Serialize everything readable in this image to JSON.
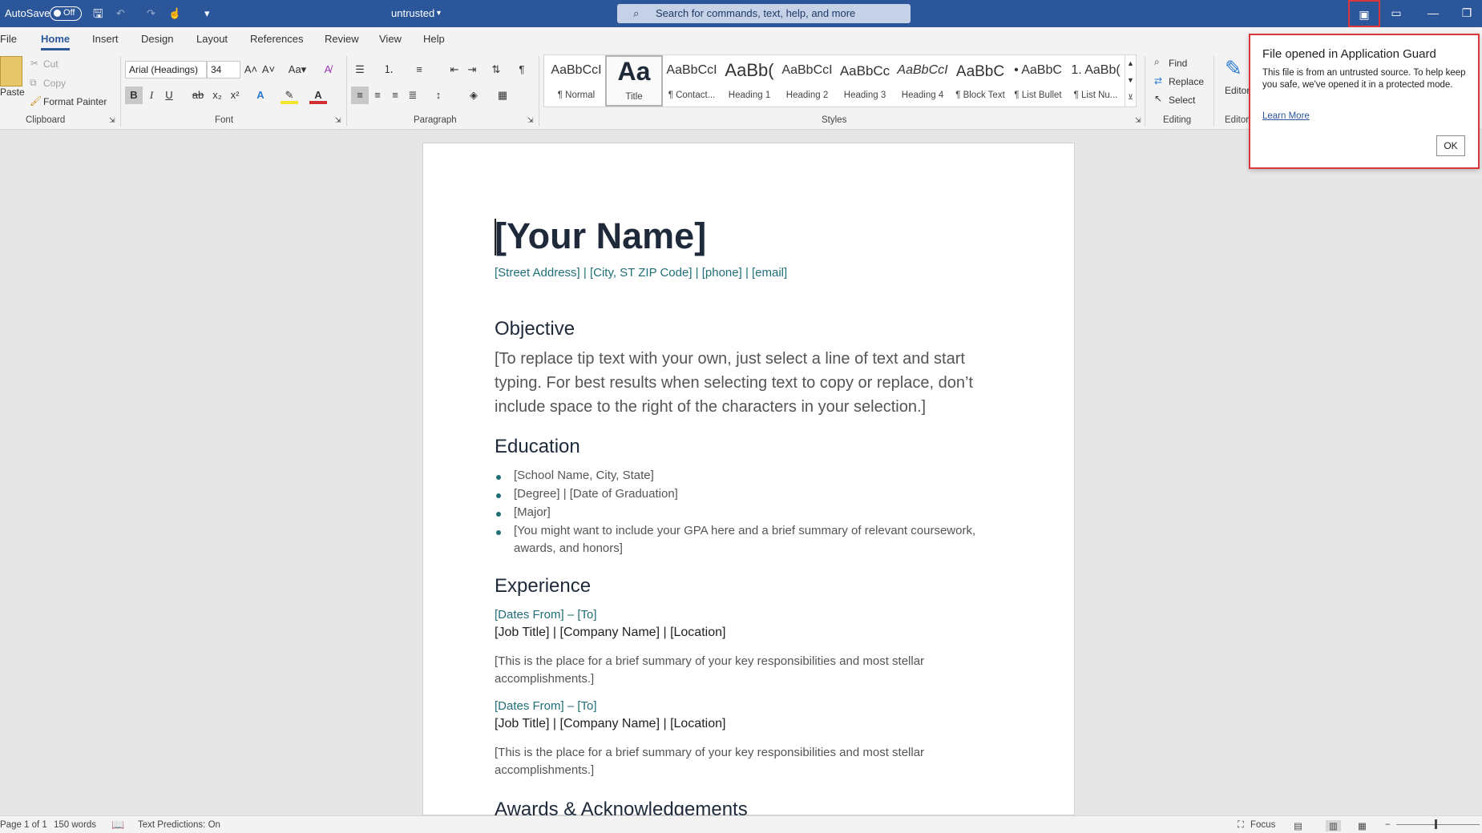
{
  "titlebar": {
    "autosave_label": "AutoSave",
    "autosave_state": "Off",
    "doc_title": "untrusted",
    "search_placeholder": "Search for commands, text, help, and more"
  },
  "tabs": [
    "File",
    "Home",
    "Insert",
    "Design",
    "Layout",
    "References",
    "Review",
    "View",
    "Help"
  ],
  "ribbon": {
    "clipboard": {
      "paste": "Paste",
      "cut": "Cut",
      "copy": "Copy",
      "format_painter": "Format Painter",
      "label": "Clipboard"
    },
    "font": {
      "font_name": "Arial (Headings)",
      "font_size": "34",
      "label": "Font"
    },
    "paragraph": {
      "label": "Paragraph"
    },
    "styles": {
      "label": "Styles",
      "items": [
        {
          "preview": "AaBbCcI",
          "name": "¶ Normal"
        },
        {
          "preview": "Aa",
          "name": "Title"
        },
        {
          "preview": "AaBbCcI",
          "name": "¶ Contact..."
        },
        {
          "preview": "AaBb(",
          "name": "Heading 1"
        },
        {
          "preview": "AaBbCcI",
          "name": "Heading 2"
        },
        {
          "preview": "AaBbCc",
          "name": "Heading 3"
        },
        {
          "preview": "AaBbCcI",
          "name": "Heading 4"
        },
        {
          "preview": "AaBbC",
          "name": "¶ Block Text"
        },
        {
          "preview": "• AaBbC",
          "name": "¶ List Bullet"
        },
        {
          "preview": "1. AaBb(",
          "name": "¶ List Nu..."
        }
      ]
    },
    "editing": {
      "find": "Find",
      "replace": "Replace",
      "select": "Select",
      "label": "Editing"
    },
    "editor": {
      "label": "Editor",
      "short": "Editor"
    }
  },
  "document": {
    "name": "[Your Name]",
    "contact": "[Street Address] | [City, ST ZIP Code] | [phone] | [email]",
    "objective_heading": "Objective",
    "objective_lines": [
      "[To replace tip text with your own, just select a line of text and start",
      "typing. For best results when selecting text to copy or replace, don’t",
      "include space to the right of the characters in your selection.]"
    ],
    "education_heading": "Education",
    "education_items": [
      "[School Name, City, State]",
      "[Degree] | [Date of Graduation]",
      "[Major]",
      "[You might want to include your GPA here and a brief summary of relevant coursework,",
      "awards, and honors]"
    ],
    "experience_heading": "Experience",
    "jobs": [
      {
        "dates": "[Dates From] – [To]",
        "title": "[Job Title] | [Company Name] | [Location]",
        "summary1": "[This is the place for a brief summary of your key responsibilities and most stellar",
        "summary2": "accomplishments.]"
      },
      {
        "dates": "[Dates From] – [To]",
        "title": "[Job Title] | [Company Name] | [Location]",
        "summary1": "[This is the place for a brief summary of your key responsibilities and most stellar",
        "summary2": "accomplishments.]"
      }
    ],
    "awards_heading": "Awards & Acknowledgements"
  },
  "popup": {
    "title": "File opened in Application Guard",
    "message": "This file is from an untrusted source. To help keep you safe, we've opened it in a protected mode.",
    "link": "Learn More",
    "ok": "OK"
  },
  "status": {
    "page": "Page 1 of 1",
    "words": "150 words",
    "predictions": "Text Predictions: On",
    "focus": "Focus"
  }
}
